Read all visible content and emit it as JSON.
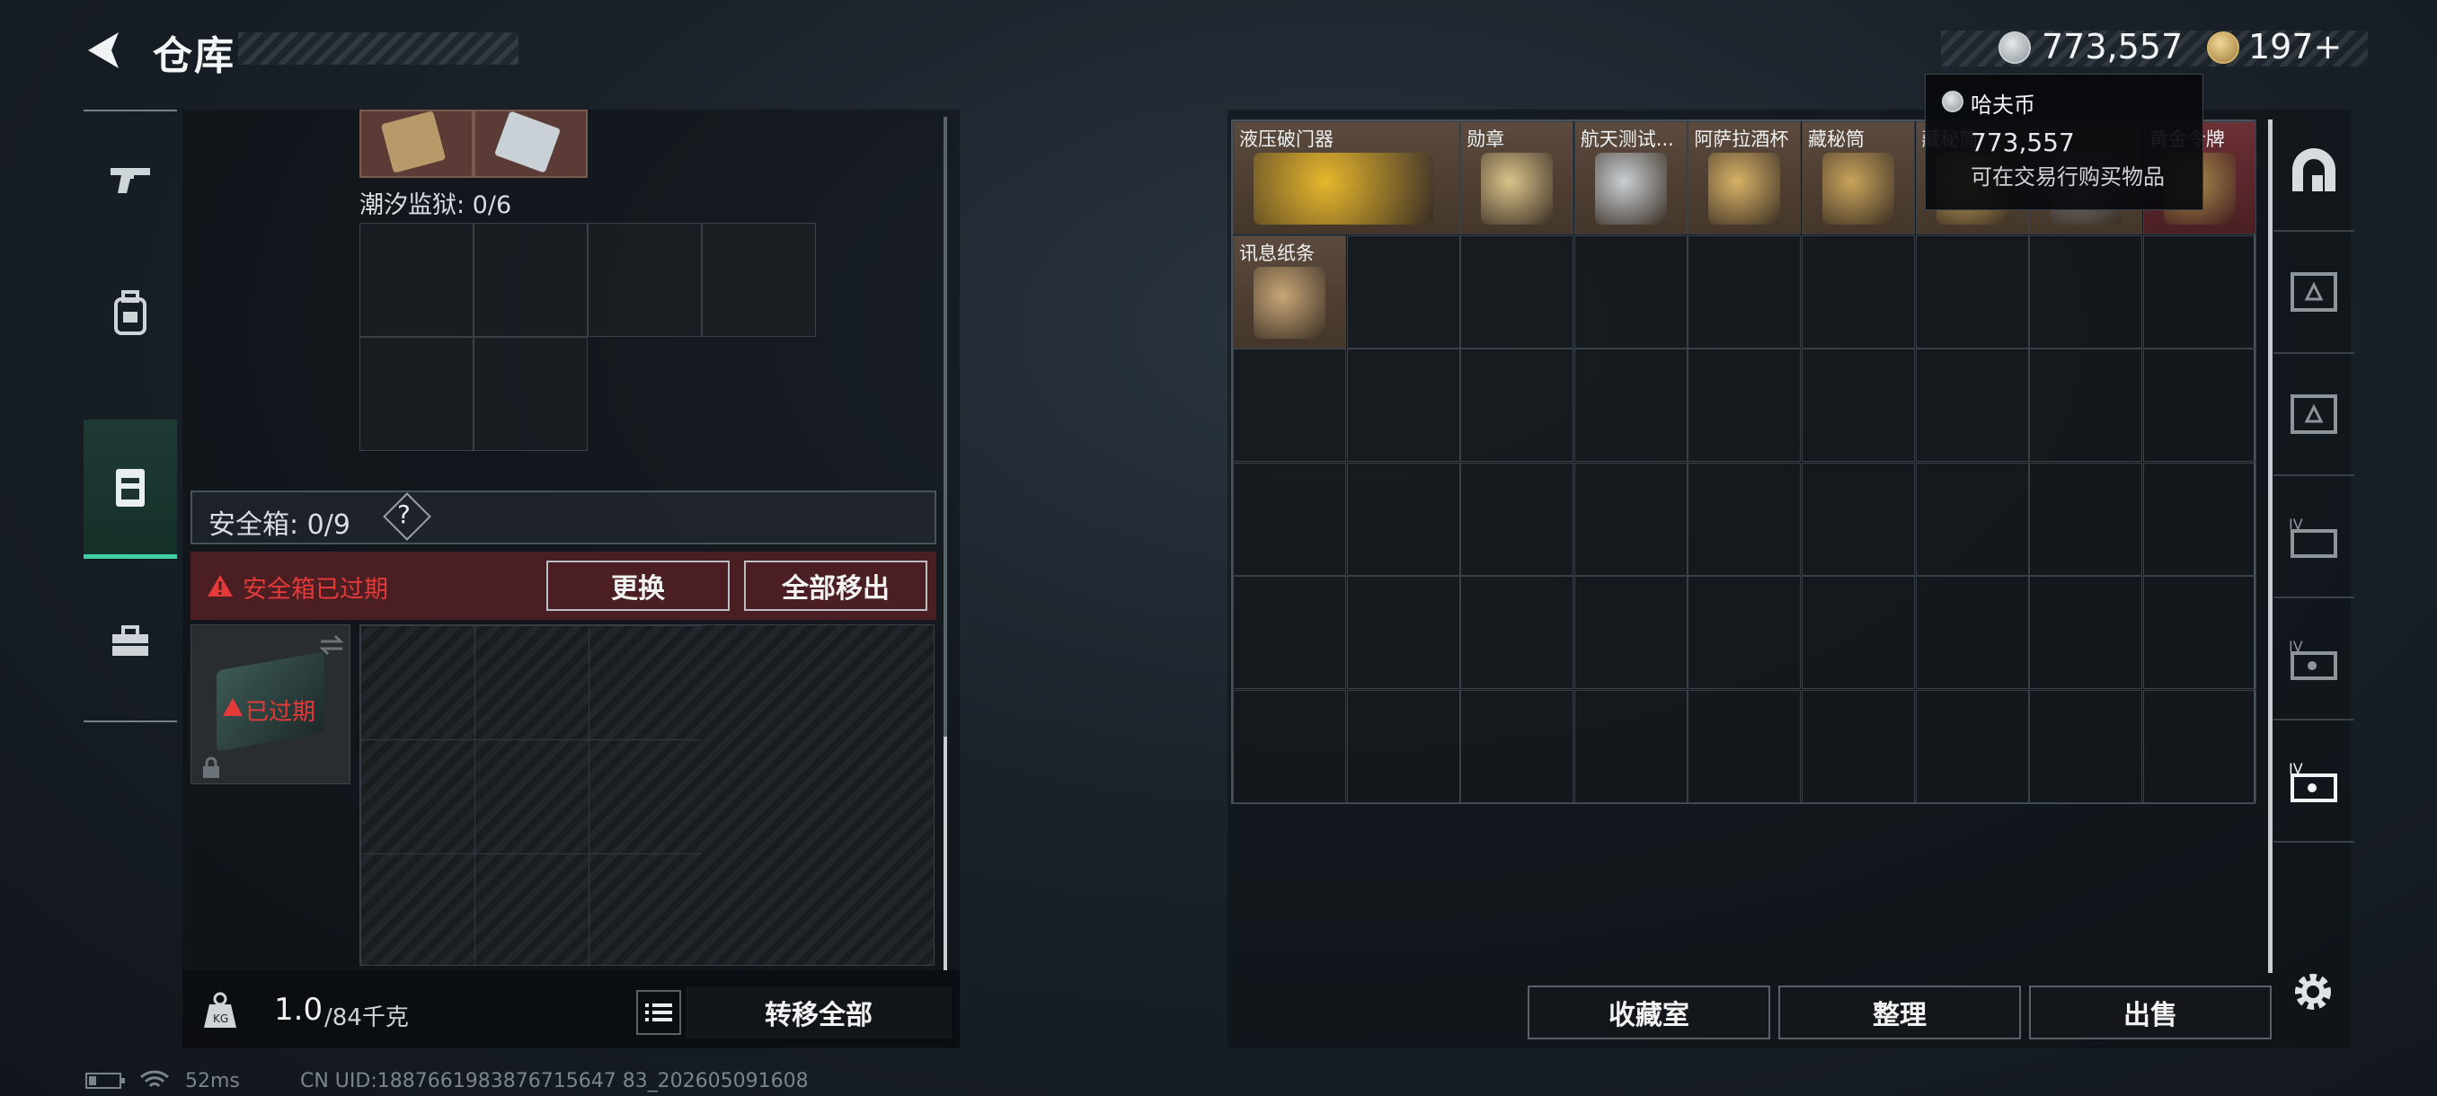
{
  "header": {
    "title": "仓库"
  },
  "currency": {
    "haf_coin": "773,557",
    "gold_coin": "197+",
    "tooltip": {
      "title": "哈夫币",
      "value": "773,557",
      "desc": "可在交易行购买物品"
    }
  },
  "left": {
    "prison_label": "潮汐监狱: 0/6",
    "safe_label": "安全箱: 0/9",
    "safe_help": "?",
    "expired_alert": "安全箱已过期",
    "replace_btn": "更换",
    "move_all_btn": "全部移出",
    "expired_tag": "已过期",
    "weight_value": "1.0",
    "weight_max": "/84千克",
    "transfer_all_btn": "转移全部"
  },
  "storage": {
    "items": [
      {
        "name": "液压破门器"
      },
      {
        "name": "勋章"
      },
      {
        "name": "航天测试..."
      },
      {
        "name": "阿萨拉酒杯"
      },
      {
        "name": "藏秘筒"
      },
      {
        "name": "藏秘筒"
      },
      {
        "name": ""
      },
      {
        "name": "黄金令牌"
      },
      {
        "name": "讯息纸条"
      }
    ],
    "buttons": {
      "collection": "收藏室",
      "sort": "整理",
      "sell": "出售"
    }
  },
  "footer": {
    "ping": "52ms",
    "uid": "CN UID:1887661983876715647 83_202605091608"
  },
  "colors": {
    "accent": "#3fd0a3",
    "alert": "#e43a3a"
  }
}
